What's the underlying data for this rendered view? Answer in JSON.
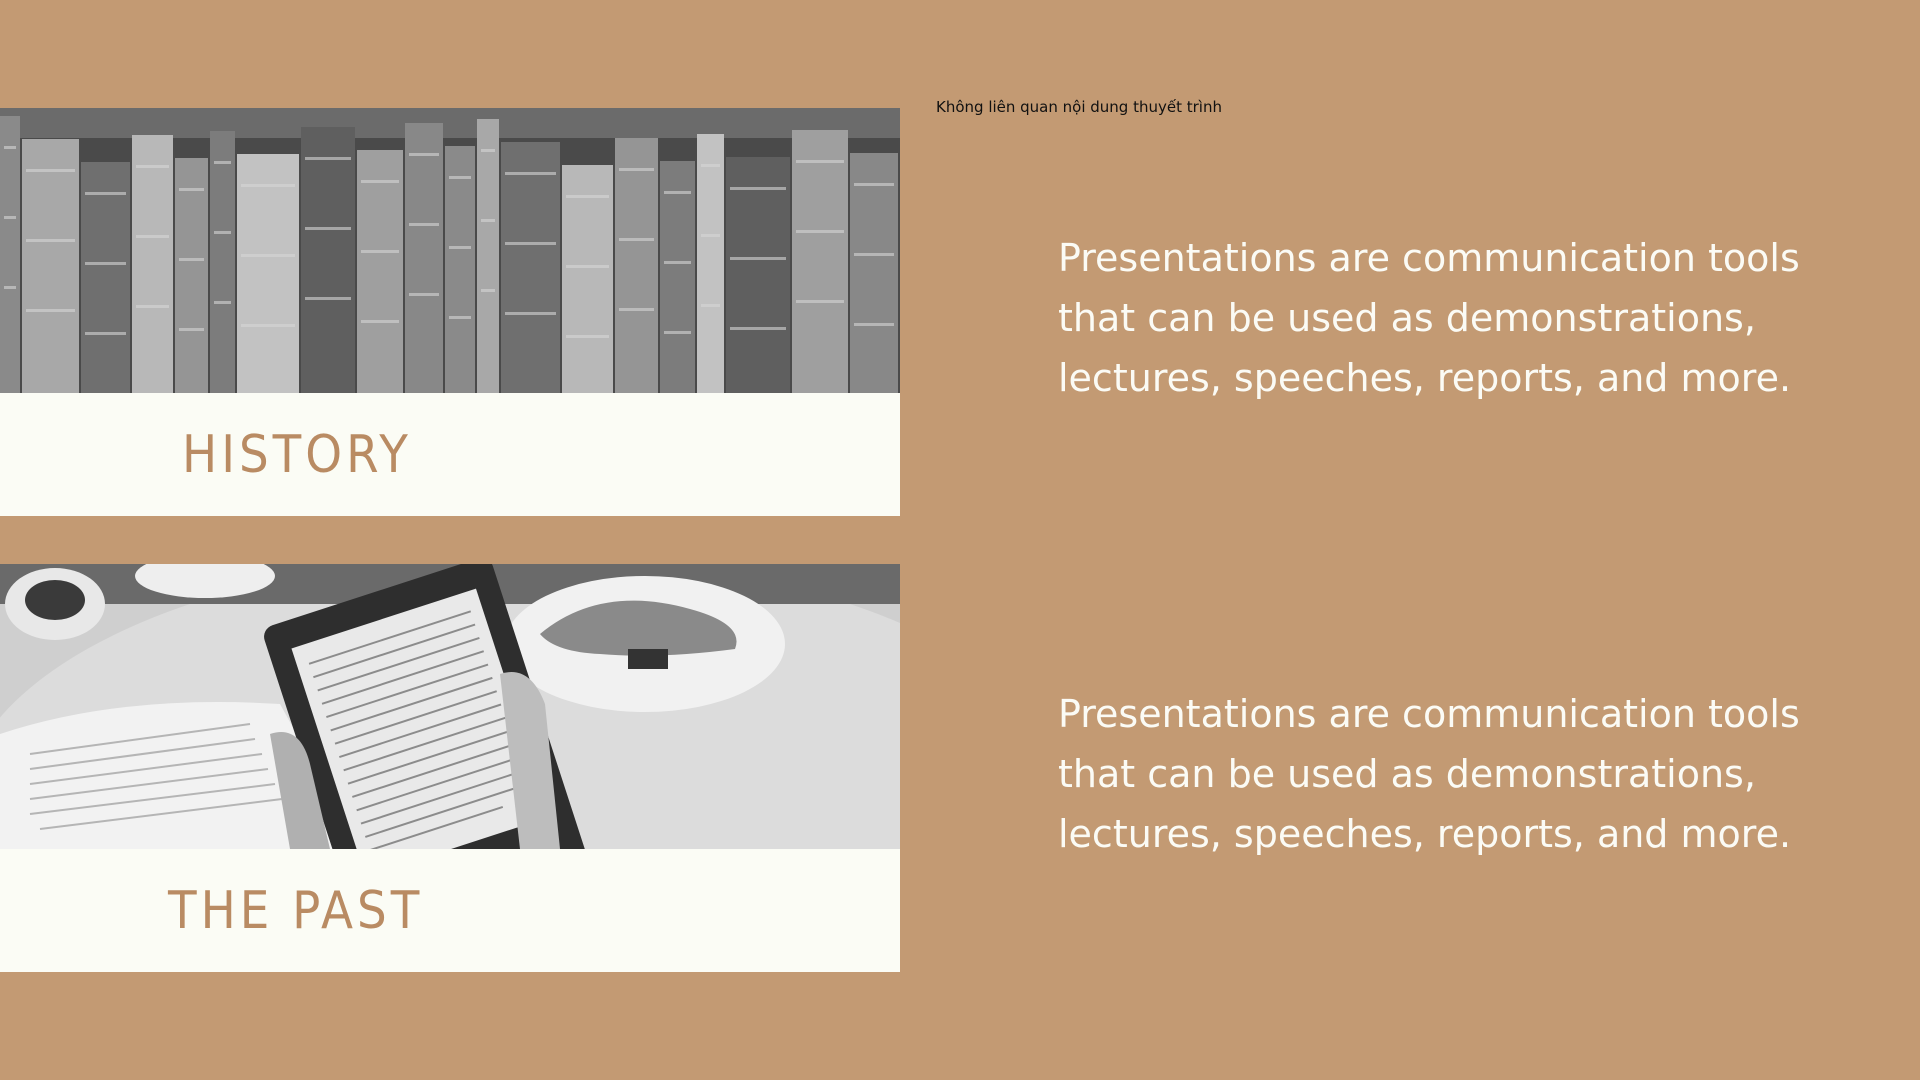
{
  "colors": {
    "background": "#c39a73",
    "panel": "#fbfcf5",
    "heading": "#b98b63",
    "body_text": "#fbfbf5"
  },
  "note": "Không liên quan nội dung thuyết trình",
  "sections": [
    {
      "heading": "HISTORY",
      "image": "old-books-photo",
      "body": "Presentations are communication tools that can be used as demonstrations, lectures, speeches, reports, and more."
    },
    {
      "heading": "THE PAST",
      "image": "ereader-photo",
      "body": "Presentations are communication tools that can be used as demonstrations, lectures, speeches, reports, and more."
    }
  ]
}
